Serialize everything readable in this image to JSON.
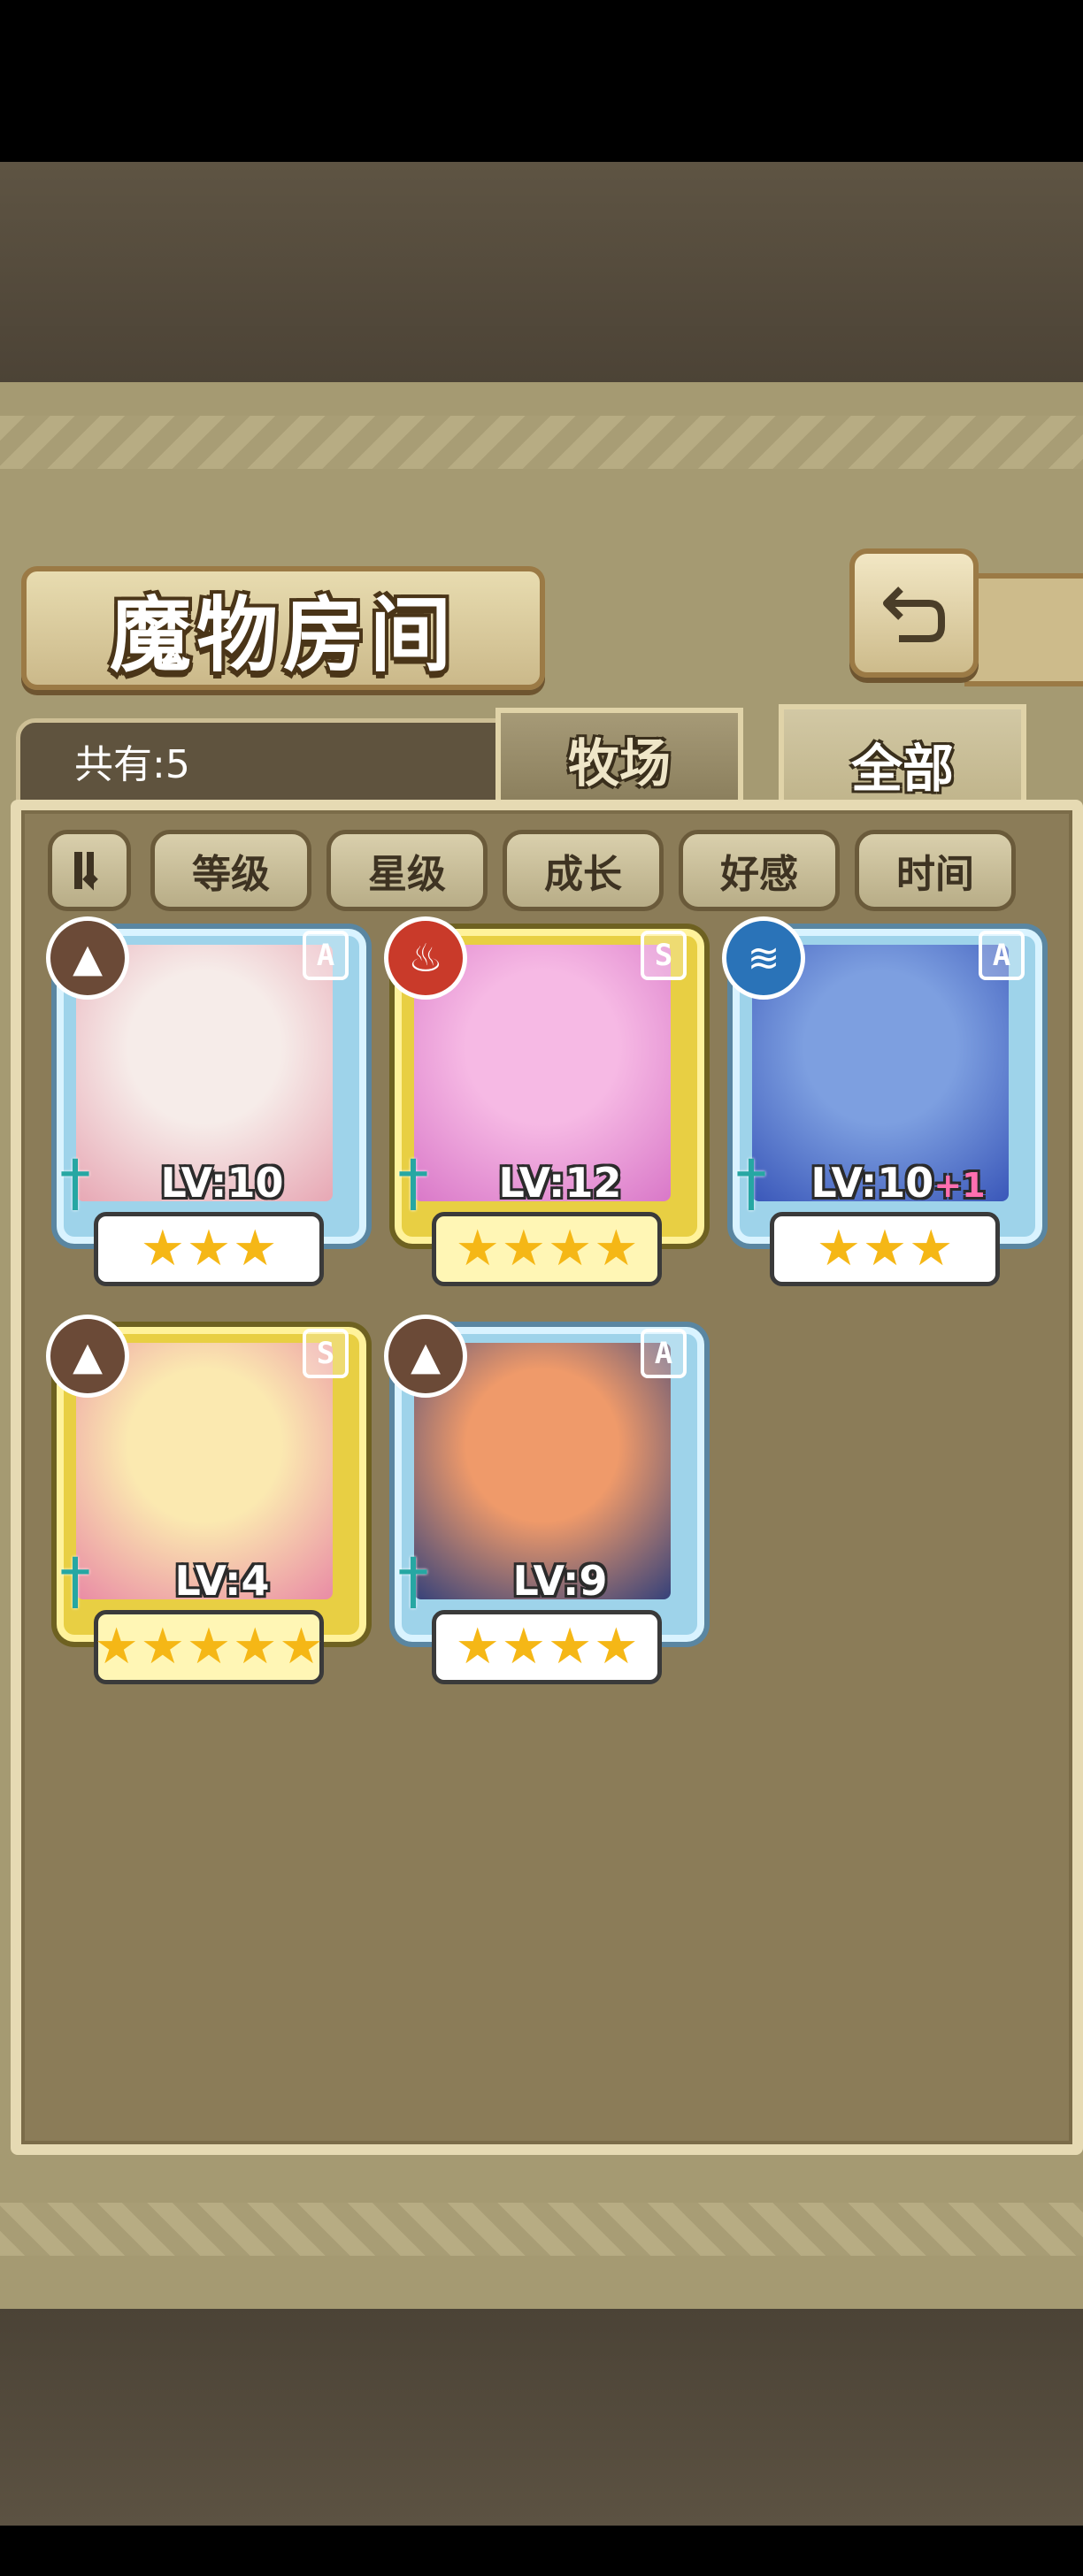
{
  "title": "魔物房间",
  "count_label": "共有:5",
  "tabs": [
    {
      "label": "牧场",
      "active": false
    },
    {
      "label": "全部",
      "active": true
    }
  ],
  "sort_buttons": [
    "等级",
    "星级",
    "成长",
    "好感",
    "时间"
  ],
  "sort_order_icon": "sort-order-icon",
  "back_icon": "return-arrow-icon",
  "monsters": [
    {
      "element": "earth",
      "element_icon": "mountain-icon",
      "rank": "A",
      "level": "LV:10",
      "level_bonus": "",
      "stars": 3,
      "frame": "a",
      "portrait_colors": [
        "#f6ece9",
        "#e7a7b4"
      ]
    },
    {
      "element": "fire",
      "element_icon": "flame-icon",
      "rank": "S",
      "level": "LV:12",
      "level_bonus": "",
      "stars": 4,
      "frame": "s",
      "portrait_colors": [
        "#f6b9e4",
        "#d978c8"
      ]
    },
    {
      "element": "water",
      "element_icon": "waves-icon",
      "rank": "A",
      "level": "LV:10",
      "level_bonus": "+1",
      "stars": 3,
      "frame": "a",
      "portrait_colors": [
        "#7d9fe0",
        "#3a57b9"
      ]
    },
    {
      "element": "earth",
      "element_icon": "mountain-icon",
      "rank": "S",
      "level": "LV:4",
      "level_bonus": "",
      "stars": 5,
      "frame": "s",
      "portrait_colors": [
        "#fbe9b0",
        "#e98ba5"
      ]
    },
    {
      "element": "earth",
      "element_icon": "mountain-icon",
      "rank": "A",
      "level": "LV:9",
      "level_bonus": "",
      "stars": 4,
      "frame": "a",
      "portrait_colors": [
        "#ef9a6a",
        "#35417a"
      ]
    }
  ],
  "colors": {
    "earth": "#6b4a37",
    "fire": "#c93a2a",
    "water": "#2a73b8"
  }
}
